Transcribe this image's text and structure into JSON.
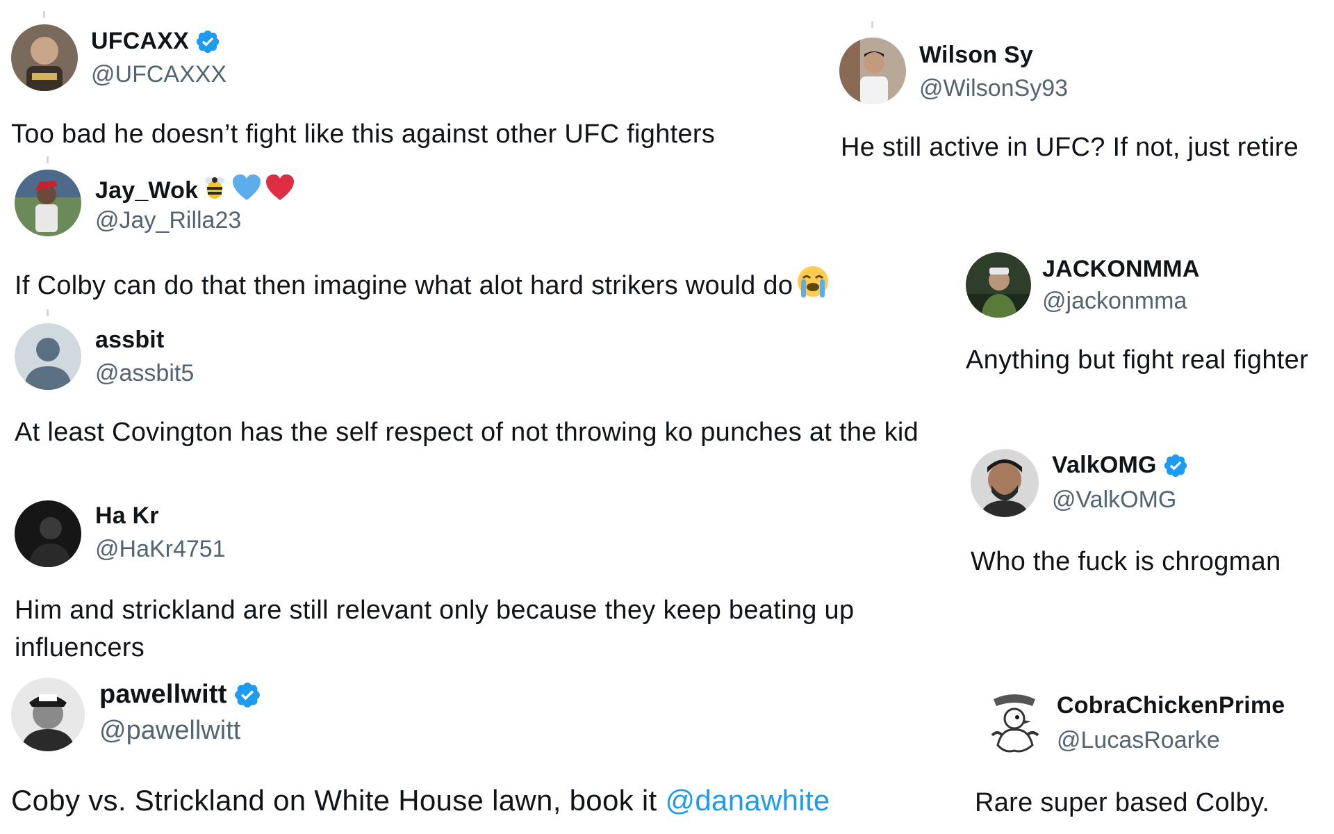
{
  "colors": {
    "verified": "#1d9bf0",
    "mention": "#1d9bf0",
    "handle": "#536471",
    "text": "#0f1419"
  },
  "left_column": [
    {
      "name": "UFCAXX",
      "handle": "@UFCAXXX",
      "verified": true,
      "avatar": "fighter-photo",
      "text": "Too bad he doesn’t fight like this against other UFC fighters"
    },
    {
      "name": "Jay_Wok",
      "name_emoji": [
        "bee-emoji",
        "blue-heart-emoji",
        "red-heart-emoji"
      ],
      "handle": "@Jay_Rilla23",
      "verified": false,
      "avatar": "game-character-photo",
      "text": "If Colby can do that then imagine what alot hard strikers would do",
      "text_emoji": "loudly-crying-face-emoji"
    },
    {
      "name": "assbit",
      "handle": "@assbit5",
      "verified": false,
      "avatar": "default-profile",
      "text": "At least Covington has the self respect of not throwing ko punches at the kid"
    },
    {
      "name": "Ha Kr",
      "handle": "@HaKr4751",
      "verified": false,
      "avatar": "dark-photo",
      "text": "Him and strickland are still relevant only because they keep beating up influencers"
    },
    {
      "name": "pawellwitt",
      "handle": "@pawellwitt",
      "verified": true,
      "avatar": "bw-portrait-ko-cap",
      "text": "Coby vs. Strickland on White House lawn, book it ",
      "mention": "@danawhite"
    }
  ],
  "right_column": [
    {
      "name": "Wilson Sy",
      "handle": "@WilsonSy93",
      "verified": false,
      "avatar": "man-photo",
      "text": "He still active in UFC? If not, just retire"
    },
    {
      "name": "JACKONMMA",
      "handle": "@jackonmma",
      "verified": false,
      "avatar": "green-photo",
      "text": "Anything but fight real fighter"
    },
    {
      "name": "ValkOMG",
      "handle": "@ValkOMG",
      "verified": true,
      "avatar": "bearded-man-photo",
      "text": "Who the fuck is chrogman"
    },
    {
      "name": "CobraChickenPrime",
      "handle": "@LucasRoarke",
      "verified": false,
      "avatar": "cartoon-chicken-logo",
      "text": "Rare super based Colby."
    }
  ]
}
